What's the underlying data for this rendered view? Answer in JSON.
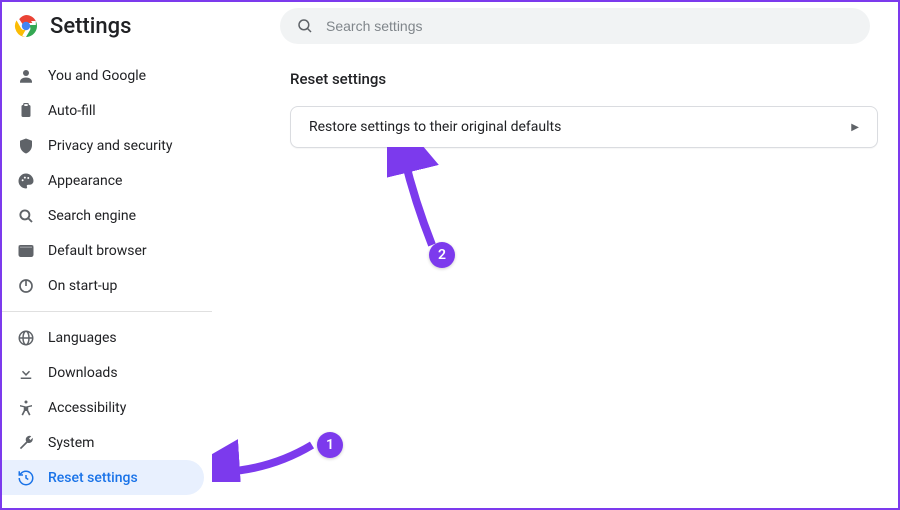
{
  "header": {
    "title": "Settings",
    "search_placeholder": "Search settings"
  },
  "sidebar": {
    "group1": [
      {
        "icon": "person",
        "label": "You and Google"
      },
      {
        "icon": "clipboard",
        "label": "Auto-fill"
      },
      {
        "icon": "shield",
        "label": "Privacy and security"
      },
      {
        "icon": "palette",
        "label": "Appearance"
      },
      {
        "icon": "search",
        "label": "Search engine"
      },
      {
        "icon": "browser",
        "label": "Default browser"
      },
      {
        "icon": "power",
        "label": "On start-up"
      }
    ],
    "group2": [
      {
        "icon": "globe",
        "label": "Languages"
      },
      {
        "icon": "download",
        "label": "Downloads"
      },
      {
        "icon": "accessibility",
        "label": "Accessibility"
      },
      {
        "icon": "wrench",
        "label": "System"
      },
      {
        "icon": "restore",
        "label": "Reset settings",
        "selected": true
      }
    ]
  },
  "content": {
    "section_title": "Reset settings",
    "card_text": "Restore settings to their original defaults"
  },
  "annotations": {
    "badge1": "1",
    "badge2": "2"
  }
}
